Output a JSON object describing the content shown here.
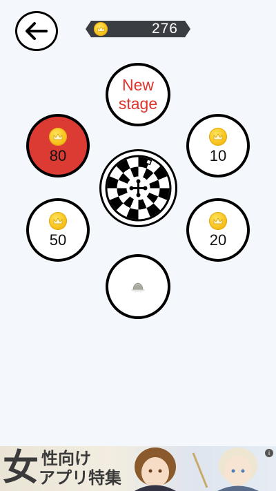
{
  "header": {
    "back_icon": "arrow-left-icon",
    "balance": "276",
    "coin_icon": "crown-coin-icon"
  },
  "stages": {
    "new_stage_line1": "New",
    "new_stage_line2": "stage"
  },
  "slots": [
    {
      "amount": "80",
      "selected": true,
      "color": "#db3b32"
    },
    {
      "amount": "10",
      "selected": false
    },
    {
      "amount": "50",
      "selected": false
    },
    {
      "amount": "20",
      "selected": false
    }
  ],
  "center": {
    "icon": "roulette-wheel-icon"
  },
  "bottom_slot": {
    "icon": "rock-icon"
  },
  "ad": {
    "line_big": "女",
    "line1": "性向け",
    "line2": "アプリ特集",
    "info_label": "i"
  }
}
